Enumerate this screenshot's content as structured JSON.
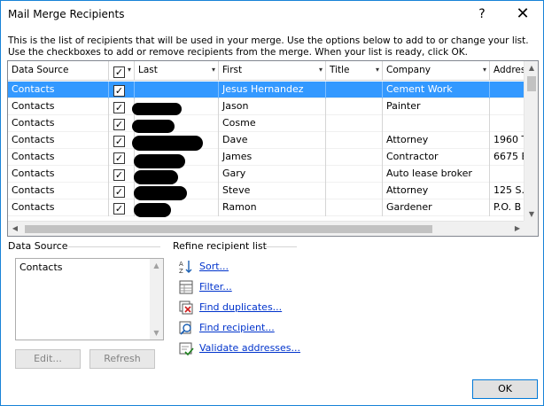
{
  "window": {
    "title": "Mail Merge Recipients",
    "help_glyph": "?",
    "close_glyph": "✕"
  },
  "intro": {
    "line1": "This is the list of recipients that will be used in your merge.  Use the options below to add to or change your list.",
    "line2": "Use the checkboxes to add or remove recipients from the merge.  When your list is ready, click OK."
  },
  "grid": {
    "columns": [
      "Data Source",
      "",
      "Last",
      "First",
      "Title",
      "Company",
      "Addres"
    ],
    "rows": [
      {
        "source": "Contacts",
        "checked": true,
        "last": "",
        "first": "Jesus Hernandez",
        "title": "",
        "company": "Cement Work",
        "address": "",
        "selected": true
      },
      {
        "source": "Contacts",
        "checked": true,
        "last": "",
        "first": "Jason",
        "title": "",
        "company": "Painter",
        "address": ""
      },
      {
        "source": "Contacts",
        "checked": true,
        "last": "",
        "first": "Cosme",
        "title": "",
        "company": "",
        "address": ""
      },
      {
        "source": "Contacts",
        "checked": true,
        "last": "",
        "first": "Dave",
        "title": "",
        "company": "Attorney",
        "address": "1960 T"
      },
      {
        "source": "Contacts",
        "checked": true,
        "last": "",
        "first": "James",
        "title": "",
        "company": "Contractor",
        "address": "6675 B"
      },
      {
        "source": "Contacts",
        "checked": true,
        "last": "",
        "first": "Gary",
        "title": "",
        "company": "Auto lease broker",
        "address": ""
      },
      {
        "source": "Contacts",
        "checked": true,
        "last": "",
        "first": "Steve",
        "title": "",
        "company": "Attorney",
        "address": "125 S."
      },
      {
        "source": "Contacts",
        "checked": true,
        "last": "",
        "first": "Ramon",
        "title": "",
        "company": "Gardener",
        "address": "P.O. B"
      }
    ]
  },
  "data_source": {
    "label": "Data Source",
    "items": [
      "Contacts"
    ],
    "edit_label": "Edit...",
    "refresh_label": "Refresh"
  },
  "refine": {
    "label": "Refine recipient list",
    "links": [
      {
        "label": "Sort...",
        "icon": "sort-icon"
      },
      {
        "label": "Filter...",
        "icon": "filter-icon"
      },
      {
        "label": "Find duplicates...",
        "icon": "find-duplicates-icon"
      },
      {
        "label": "Find recipient...",
        "icon": "find-recipient-icon"
      },
      {
        "label": "Validate addresses...",
        "icon": "validate-addresses-icon"
      }
    ]
  },
  "ok_label": "OK",
  "colors": {
    "selection": "#3399ff",
    "link": "#0033cc",
    "accent_border": "#0078d7"
  }
}
